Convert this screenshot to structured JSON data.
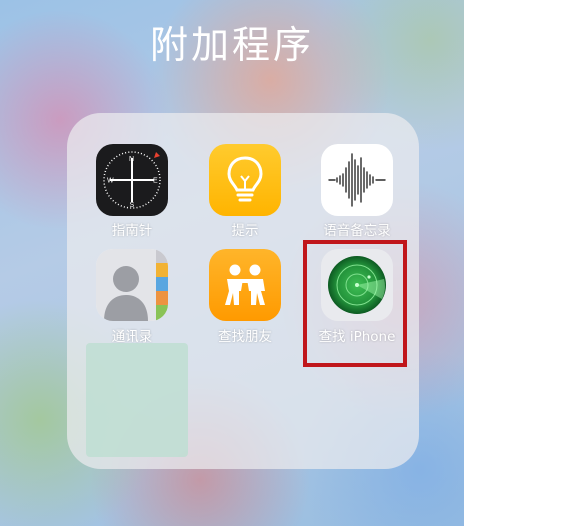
{
  "folder": {
    "title": "附加程序"
  },
  "apps": [
    {
      "id": "compass",
      "label": "指南针",
      "icon": "compass-icon"
    },
    {
      "id": "tips",
      "label": "提示",
      "icon": "lightbulb-icon"
    },
    {
      "id": "voice_memos",
      "label": "语音备忘录",
      "icon": "waveform-icon"
    },
    {
      "id": "contacts",
      "label": "通讯录",
      "icon": "contacts-icon"
    },
    {
      "id": "find_friends",
      "label": "查找朋友",
      "icon": "friends-icon"
    },
    {
      "id": "find_iphone",
      "label": "查找 iPhone",
      "icon": "radar-icon"
    }
  ],
  "highlight": {
    "target": "find_iphone",
    "color": "#c0161b"
  },
  "colors": {
    "tips": "#ffbd1c",
    "find_friends": "#ffa813",
    "radar_green": "#2e9a43"
  }
}
